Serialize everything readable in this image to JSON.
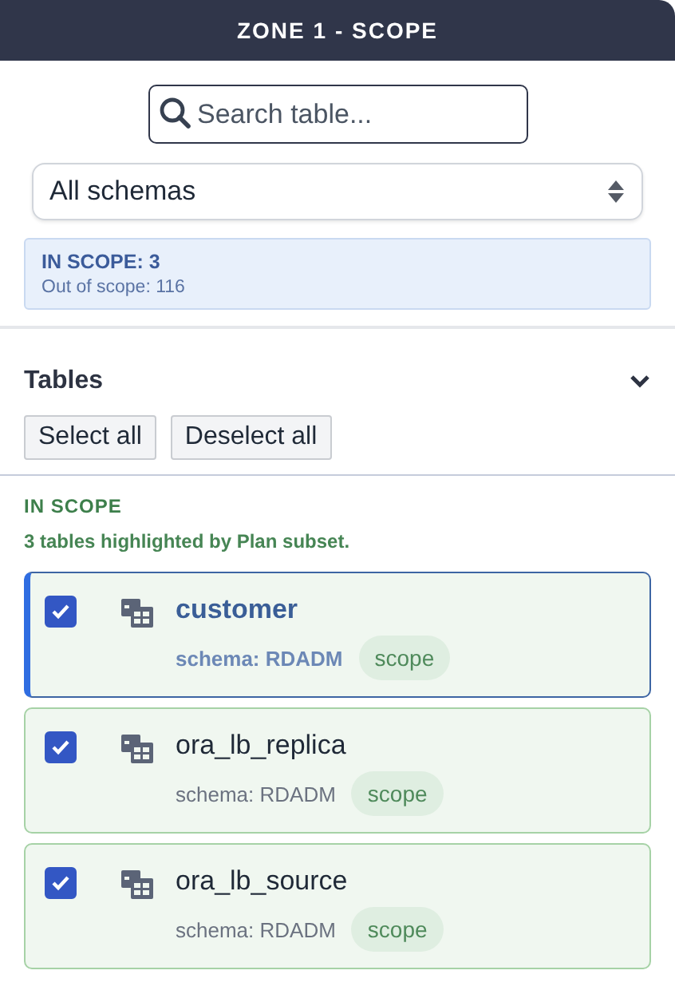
{
  "header": {
    "title": "ZONE 1 - SCOPE"
  },
  "search": {
    "placeholder": "Search table..."
  },
  "schema_select": {
    "value": "All schemas"
  },
  "summary": {
    "in_scope": "IN SCOPE: 3",
    "out_of_scope": "Out of scope: 116"
  },
  "tables_section": {
    "title": "Tables",
    "expanded": true,
    "buttons": [
      "Select all",
      "Deselect all"
    ]
  },
  "group": {
    "title": "IN SCOPE",
    "subtitle": "3 tables highlighted by Plan subset."
  },
  "tables": [
    {
      "name": "customer",
      "schema": "schema: RDADM",
      "tag": "scope",
      "checked": true,
      "selected": true
    },
    {
      "name": "ora_lb_replica",
      "schema": "schema: RDADM",
      "tag": "scope",
      "checked": true,
      "selected": false
    },
    {
      "name": "ora_lb_source",
      "schema": "schema: RDADM",
      "tag": "scope",
      "checked": true,
      "selected": false
    }
  ]
}
